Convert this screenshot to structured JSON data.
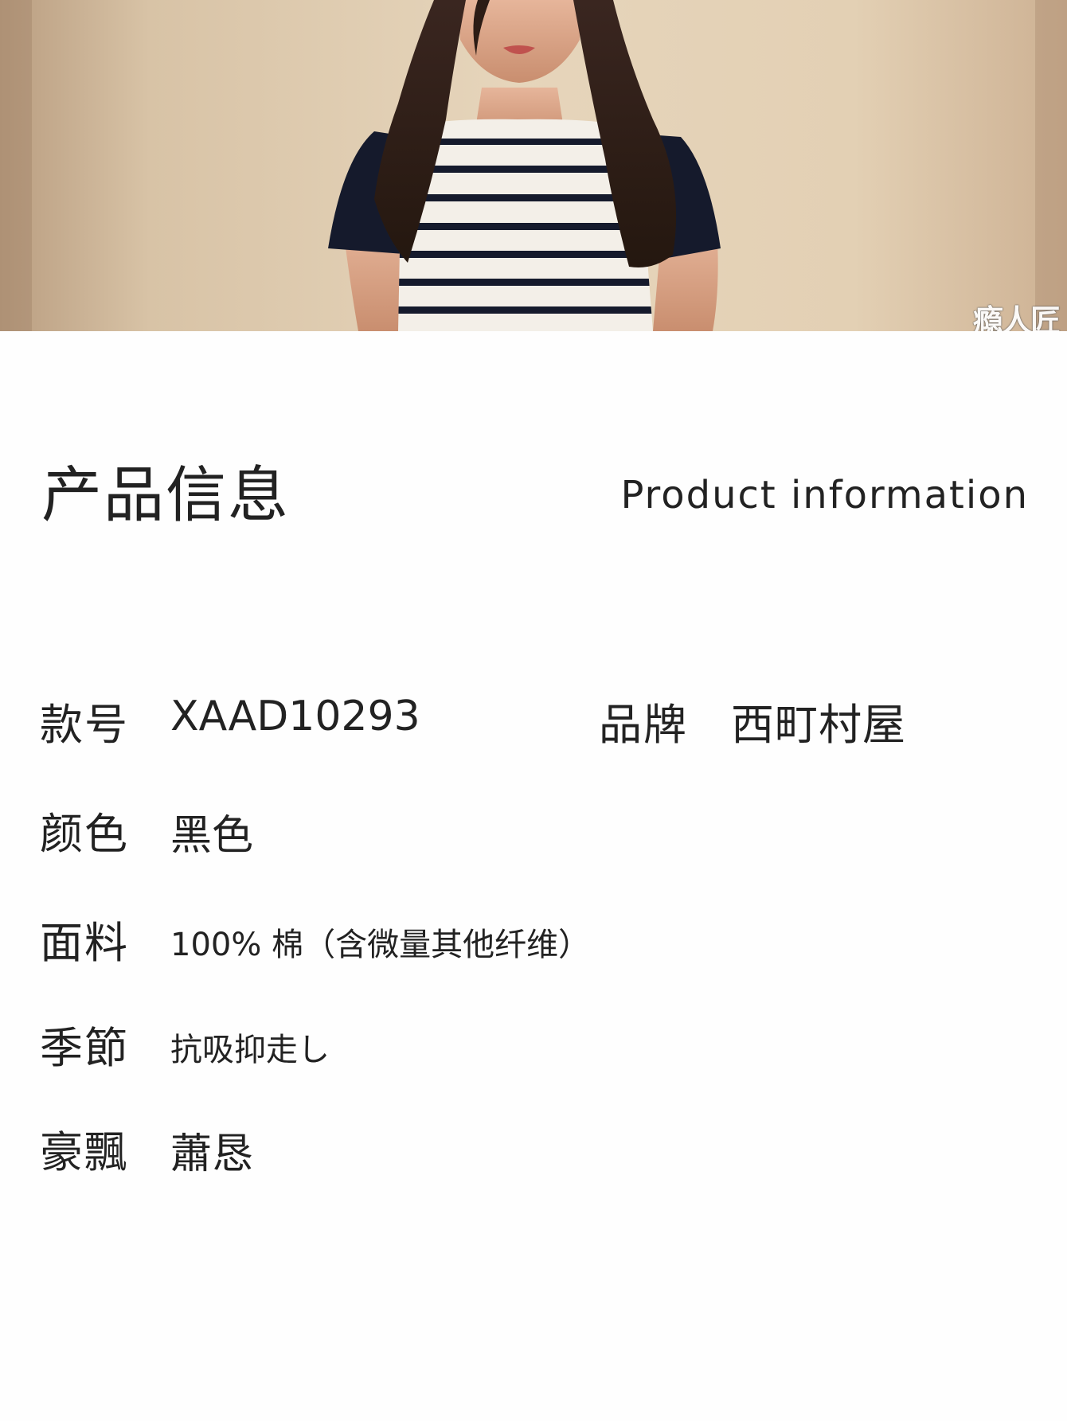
{
  "hero": {
    "icon": "product-photo",
    "watermark": "瘾人匠"
  },
  "info": {
    "title": "产品信息",
    "title_en": "Product information",
    "brand": {
      "label": "品牌",
      "value": "西町村屋"
    },
    "specs": [
      {
        "label": "款号",
        "value": "XAAD10293"
      },
      {
        "label": "颜色",
        "value": "黑色"
      },
      {
        "label": "面料",
        "value": "100% 棉（含微量其他纤维）"
      },
      {
        "label": "季節",
        "value": "抗吸抑走し"
      },
      {
        "label": "豪飄",
        "value": "蕭恳"
      }
    ]
  }
}
